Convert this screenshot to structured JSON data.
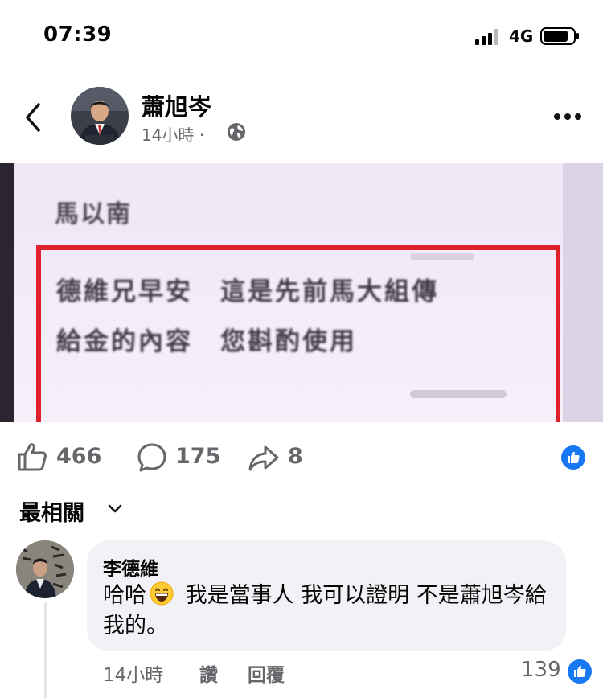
{
  "status_bar": {
    "time": "07:39",
    "network": "4G"
  },
  "post": {
    "author": "蕭旭岑",
    "time": "14小時",
    "separator": "·",
    "photo": {
      "sender_label": "馬以南",
      "highlighted_message_line1": "德維兄早安　這是先前馬大組傳",
      "highlighted_message_line2": "給金的內容　您斟酌使用",
      "accent_color": "#e0202a"
    }
  },
  "reactions": {
    "likes": "466",
    "comments": "175",
    "shares": "8"
  },
  "comments_section": {
    "sort_label": "最相關",
    "comments": [
      {
        "author": "李德維",
        "text_before_emoji": "哈哈",
        "text_after_emoji": " 我是當事人 我可以證明 不是蕭旭岑給我的。",
        "time": "14小時",
        "like_label": "讚",
        "reply_label": "回覆",
        "reaction_count": "139"
      }
    ]
  },
  "colors": {
    "facebook_blue": "#1877f2",
    "meta_gray": "#65676b",
    "bubble_bg": "#f0f2f5"
  }
}
